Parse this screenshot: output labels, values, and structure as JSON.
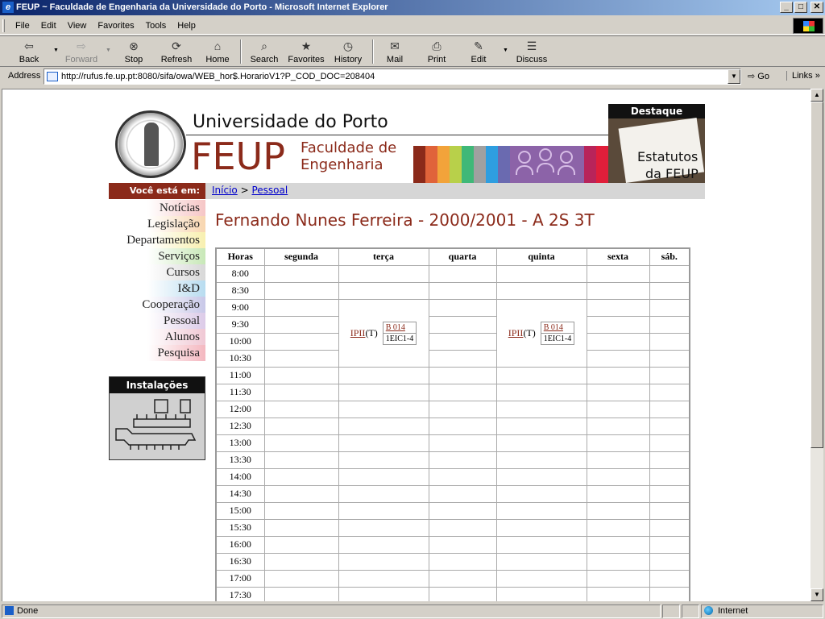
{
  "window": {
    "title": "FEUP ~ Faculdade de Engenharia da Universidade do Porto - Microsoft Internet Explorer",
    "min": "_",
    "max": "□",
    "close": "✕"
  },
  "menubar": {
    "items": [
      {
        "label": "File"
      },
      {
        "label": "Edit"
      },
      {
        "label": "View"
      },
      {
        "label": "Favorites"
      },
      {
        "label": "Tools"
      },
      {
        "label": "Help"
      }
    ]
  },
  "toolbar": {
    "back": "Back",
    "forward": "Forward",
    "stop": "Stop",
    "refresh": "Refresh",
    "home": "Home",
    "search": "Search",
    "favorites": "Favorites",
    "history": "History",
    "mail": "Mail",
    "print": "Print",
    "edit": "Edit",
    "discuss": "Discuss"
  },
  "address": {
    "label": "Address",
    "url": "http://rufus.fe.up.pt:8080/sifa/owa/WEB_hor$.HorarioV1?P_COD_DOC=208404",
    "go": "Go",
    "links": "Links"
  },
  "header": {
    "university": "Universidade do Porto",
    "feup": "FEUP",
    "faculty_line1": "Faculdade de",
    "faculty_line2": "Engenharia",
    "destaque_title": "Destaque",
    "destaque_line1": "Estatutos",
    "destaque_line2": "da FEUP"
  },
  "breadcrumb": {
    "label": "Você está em:",
    "home": "Início",
    "separator": ">",
    "current": "Pessoal"
  },
  "sidenav": {
    "items": [
      {
        "label": "Notícias",
        "color": "#f6c6c6"
      },
      {
        "label": "Legislação",
        "color": "#f8d6b0"
      },
      {
        "label": "Departamentos",
        "color": "#f8f0b0"
      },
      {
        "label": "Serviços",
        "color": "#c8e8b8"
      },
      {
        "label": "Cursos",
        "color": "#d8d8d8"
      },
      {
        "label": "I&D",
        "color": "#b8dcf0"
      },
      {
        "label": "Cooperação",
        "color": "#c8c8e8"
      },
      {
        "label": "Pessoal",
        "color": "#dccbe8"
      },
      {
        "label": "Alunos",
        "color": "#f0c8d4"
      },
      {
        "label": "Pesquisa",
        "color": "#f4b8c0"
      }
    ]
  },
  "installations": {
    "title": "Instalações"
  },
  "page": {
    "title": "Fernando Nunes Ferreira - 2000/2001 - A 2S 3T"
  },
  "schedule": {
    "headers": [
      "Horas",
      "segunda",
      "terça",
      "quarta",
      "quinta",
      "sexta",
      "sáb."
    ],
    "hours": [
      "8:00",
      "8:30",
      "9:00",
      "9:30",
      "10:00",
      "10:30",
      "11:00",
      "11:30",
      "12:00",
      "12:30",
      "13:00",
      "13:30",
      "14:00",
      "14:30",
      "15:00",
      "15:30",
      "16:00",
      "16:30",
      "17:00",
      "17:30"
    ],
    "classes": [
      {
        "course": "IPII",
        "type": "(T)",
        "room": "B 014",
        "group": "1EIC1-4",
        "day": "terça"
      },
      {
        "course": "IPII",
        "type": "(T)",
        "room": "B 014",
        "group": "1EIC1-4",
        "day": "quinta"
      }
    ]
  },
  "statusbar": {
    "status": "Done",
    "zone": "Internet"
  },
  "colors": {
    "brand": "#8b2a1a",
    "link": "#0000cc",
    "titlebar_start": "#0a246a",
    "titlebar_end": "#a6caf0"
  }
}
